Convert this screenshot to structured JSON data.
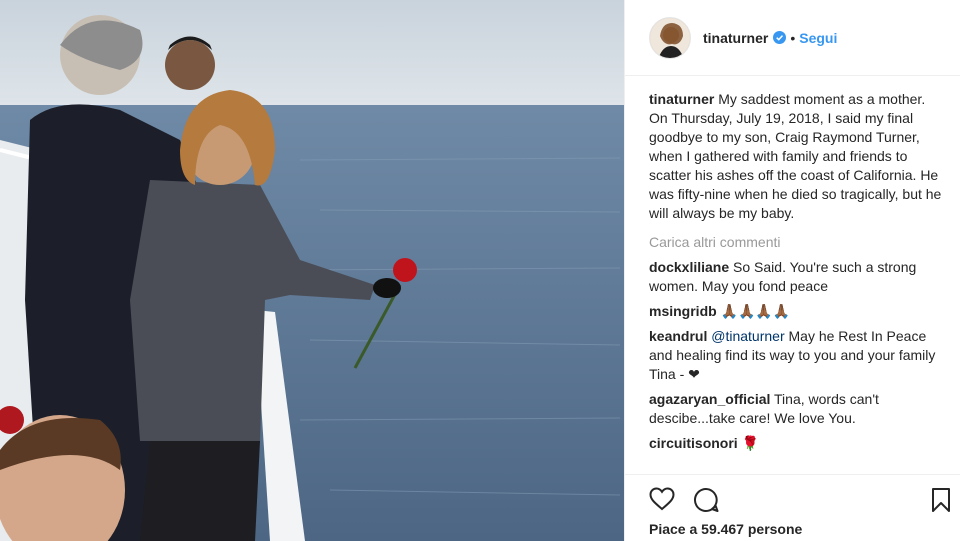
{
  "post": {
    "username": "tinaturner",
    "follow_label": "Segui",
    "dot": "•",
    "caption_user": "tinaturner",
    "caption_text": " My saddest moment as a mother. On Thursday, July 19, 2018, I said my final goodbye to my son, Craig Raymond Turner, when I gathered with family and friends to scatter his ashes off the coast of California. He was fifty-nine when he died so tragically, but he will always be my baby.",
    "load_more": "Carica altri commenti",
    "likes": "Piace a 59.467 persone"
  },
  "comments": [
    {
      "user": "dockxliliane",
      "text": " So Said. You're such a strong women. May you fond peace"
    },
    {
      "user": "msingridb",
      "text": " 🙏🏾🙏🏾🙏🏾🙏🏾"
    },
    {
      "user": "keandrul",
      "mention": " @tinaturner",
      "text": " May he Rest In Peace and healing find its way to you and your family Tina - ❤"
    },
    {
      "user": "agazaryan_official",
      "text": " Tina, words can't descibe...take care! We love You."
    },
    {
      "user": "circuitisonori",
      "text": " 🌹"
    }
  ],
  "icons": {
    "verified": "verified-badge-icon",
    "like": "heart-icon",
    "comment": "comment-bubble-icon",
    "save": "bookmark-icon"
  },
  "colors": {
    "accent": "#3897f0",
    "text": "#262626",
    "muted": "#999999",
    "border": "#efefef"
  }
}
